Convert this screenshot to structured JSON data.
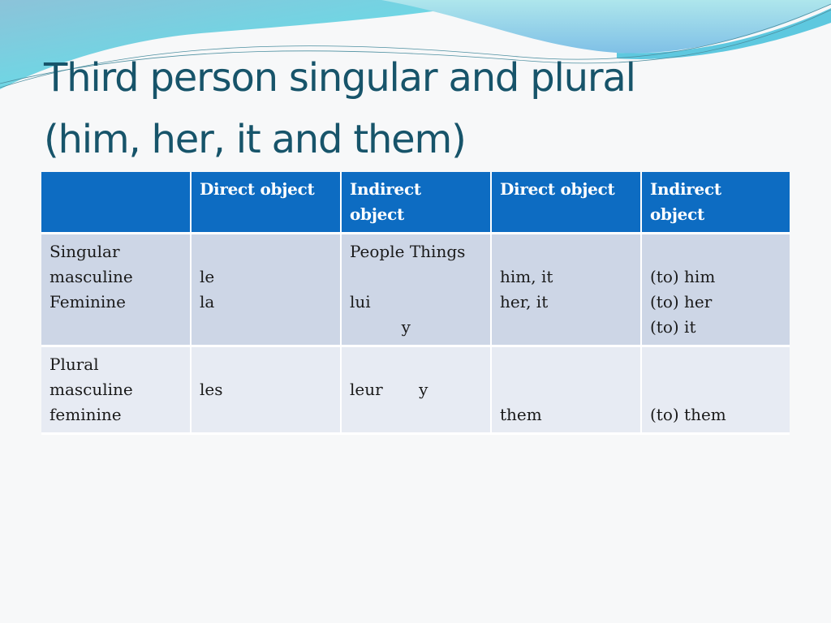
{
  "slide": {
    "title_line1": "Third person singular and plural",
    "title_line2": "(him, her, it and them)",
    "colors": {
      "title": "#17546a",
      "header_bg": "#0d6cc2",
      "row_odd_bg": "#cdd6e6",
      "row_even_bg": "#e7ebf3",
      "wave_light": "#a8e3ea",
      "wave_mid": "#6fd3e3"
    }
  },
  "table": {
    "headers": [
      "",
      "Direct object",
      "Indirect\nobject",
      "Direct object",
      "Indirect\nobject"
    ],
    "rows": [
      {
        "cells": [
          "Singular\nmasculine\nFeminine",
          "\nle\nla",
          "People Things\n\nlui\n          y",
          "\nhim, it\nher, it",
          "\n(to) him\n(to) her\n(to) it"
        ]
      },
      {
        "cells": [
          "Plural\nmasculine\nfeminine",
          "\nles",
          "\nleur       y",
          "\n\nthem",
          "\n\n(to) them"
        ]
      }
    ]
  }
}
